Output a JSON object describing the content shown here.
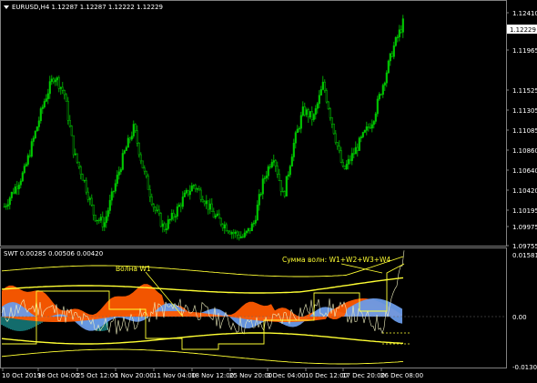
{
  "main": {
    "title": "EURUSD,H4  1.12287  1.12287  1.12222  1.12229",
    "price_marker": "1.12229",
    "price_axis": [
      "1.12410",
      "1.12195",
      "1.11965",
      "1.11525",
      "1.11305",
      "1.11085",
      "1.10860",
      "1.10640",
      "1.10420",
      "1.10195",
      "1.09975",
      "1.09755"
    ]
  },
  "indicator": {
    "title": "SWT 0.00285 0.00506 0.00420",
    "label_w1": "Волна W1",
    "label_sum": "Сумма волн: W1+W2+W3+W4",
    "axis": [
      "0.01581",
      "0.00",
      "-0.01303"
    ]
  },
  "time_axis": [
    "10 Oct 2019",
    "18 Oct 04:00",
    "25 Oct 12:00",
    "1 Nov 20:00",
    "11 Nov 04:00",
    "18 Nov 12:00",
    "25 Nov 20:00",
    "3 Dec 04:00",
    "10 Dec 12:00",
    "17 Dec 20:00",
    "26 Dec 08:00"
  ],
  "colors": {
    "background": "#000000",
    "candles": "#00c800",
    "grid": "#3a3a3a",
    "text": "#ffffff",
    "orange": "#ff5a00",
    "blue": "#6a9be8",
    "teal": "#20b4b4",
    "yellow": "#ffff33",
    "darkyellow": "#b4b400"
  },
  "chart_data": {
    "type": "candlestick",
    "symbol": "EURUSD",
    "timeframe": "H4",
    "close_path": [
      1.102,
      1.104,
      1.106,
      1.11,
      1.114,
      1.117,
      1.115,
      1.108,
      1.105,
      1.101,
      1.1,
      1.104,
      1.108,
      1.111,
      1.106,
      1.102,
      1.0995,
      1.101,
      1.103,
      1.1045,
      1.103,
      1.101,
      1.1,
      1.099,
      1.0985,
      1.1,
      1.105,
      1.108,
      1.103,
      1.109,
      1.113,
      1.112,
      1.116,
      1.111,
      1.106,
      1.108,
      1.11,
      1.112,
      1.116,
      1.12,
      1.1229
    ],
    "ylim": [
      1.09755,
      1.1241
    ]
  }
}
